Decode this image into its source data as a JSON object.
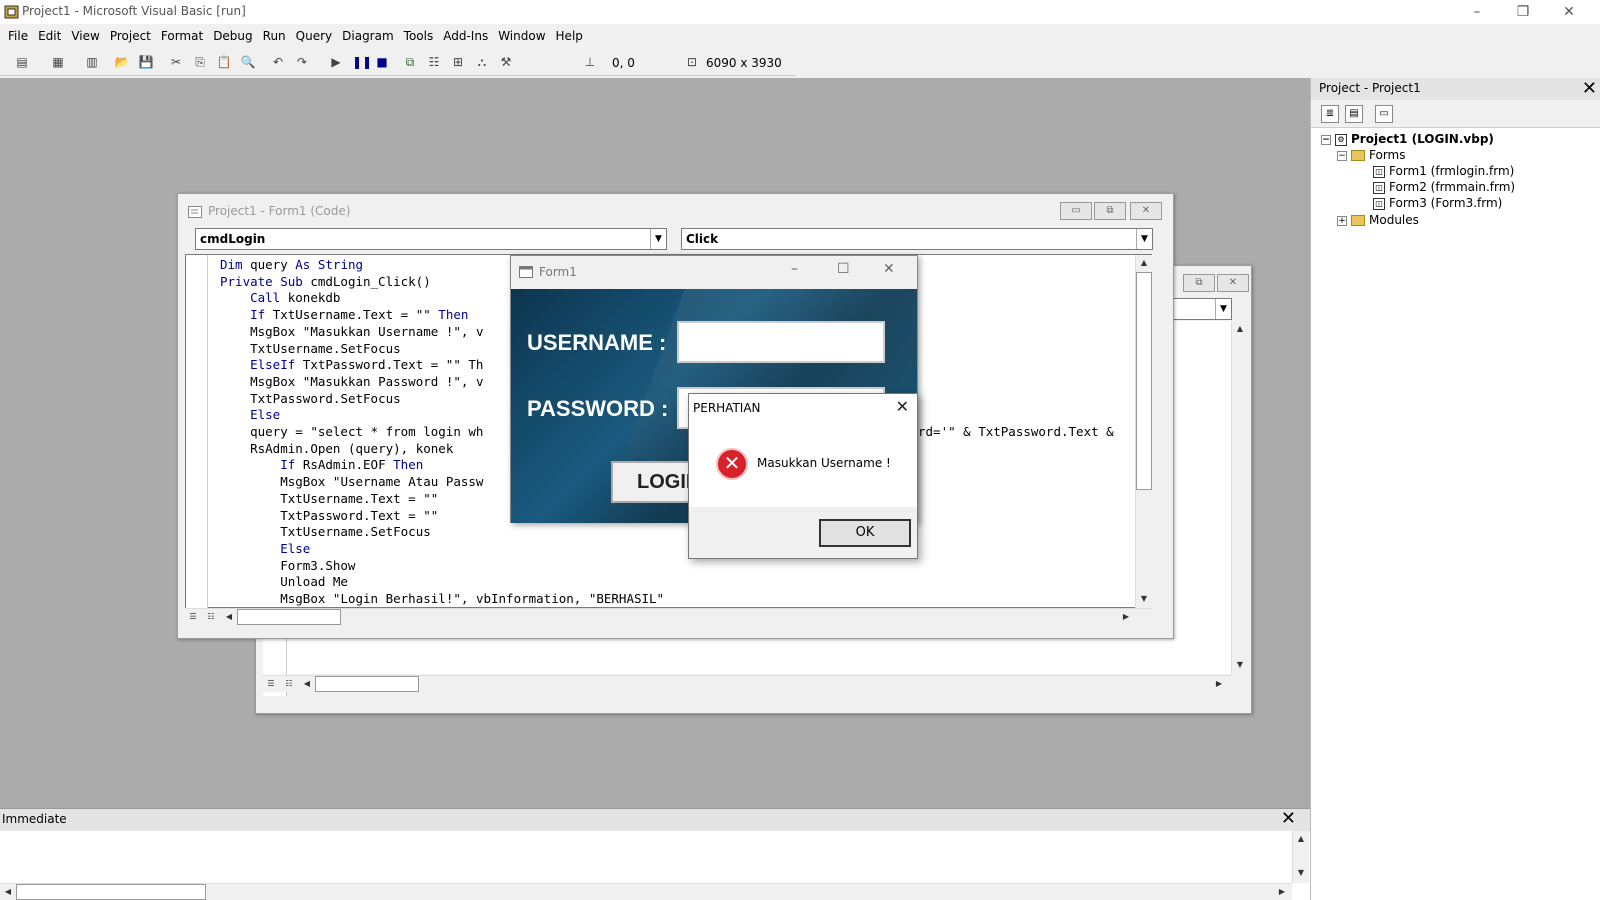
{
  "window": {
    "title": "Project1 - Microsoft Visual Basic [run]",
    "min": "–",
    "restore": "❐",
    "close": "✕"
  },
  "menu": [
    "File",
    "Edit",
    "View",
    "Project",
    "Format",
    "Debug",
    "Run",
    "Query",
    "Diagram",
    "Tools",
    "Add-Ins",
    "Window",
    "Help"
  ],
  "toolbar": {
    "position": "0, 0",
    "size": "6090 x 3930"
  },
  "code_window": {
    "title": "Project1 - Form1 (Code)",
    "object_combo": "cmdLogin",
    "proc_combo": "Click",
    "lines": [
      "Dim query As String",
      "Private Sub cmdLogin_Click()",
      "    Call konekdb",
      "    If TxtUsername.Text = \"\" Then",
      "    MsgBox \"Masukkan Username !\", v",
      "    TxtUsername.SetFocus",
      "    ElseIf TxtPassword.Text = \"\" Th",
      "    MsgBox \"Masukkan Password !\", v",
      "    TxtPassword.SetFocus",
      "    Else",
      "    query = \"select * from login wh",
      "    RsAdmin.Open (query), konek",
      "        If RsAdmin.EOF Then",
      "        MsgBox \"Username Atau Passw",
      "        TxtUsername.Text = \"\"",
      "        TxtPassword.Text = \"\"",
      "        TxtUsername.SetFocus",
      "        Else",
      "        Form3.Show",
      "        Unload Me",
      "        MsgBox \"Login Berhasil!\", vbInformation, \"BERHASIL\""
    ],
    "line_tail": "rd='\" & TxtPassword.Text &"
  },
  "form1": {
    "title": "Form1",
    "username_label": "USERNAME :",
    "password_label": "PASSWORD :",
    "login_button": "LOGIN"
  },
  "msgbox": {
    "title": "PERHATIAN",
    "message": "Masukkan Username !",
    "ok": "OK",
    "icon": "error-icon"
  },
  "project_panel": {
    "title": "Project - Project1",
    "root": "Project1 (LOGIN.vbp)",
    "forms_folder": "Forms",
    "forms": [
      "Form1 (frmlogin.frm)",
      "Form2 (frmmain.frm)",
      "Form3 (Form3.frm)"
    ],
    "modules_folder": "Modules"
  },
  "immediate": {
    "title": "Immediate"
  },
  "colors": {
    "mdi_background": "#ababab",
    "keyword": "#00008b",
    "form_gradient": "#1a5a7e",
    "error_red": "#d9212c"
  }
}
